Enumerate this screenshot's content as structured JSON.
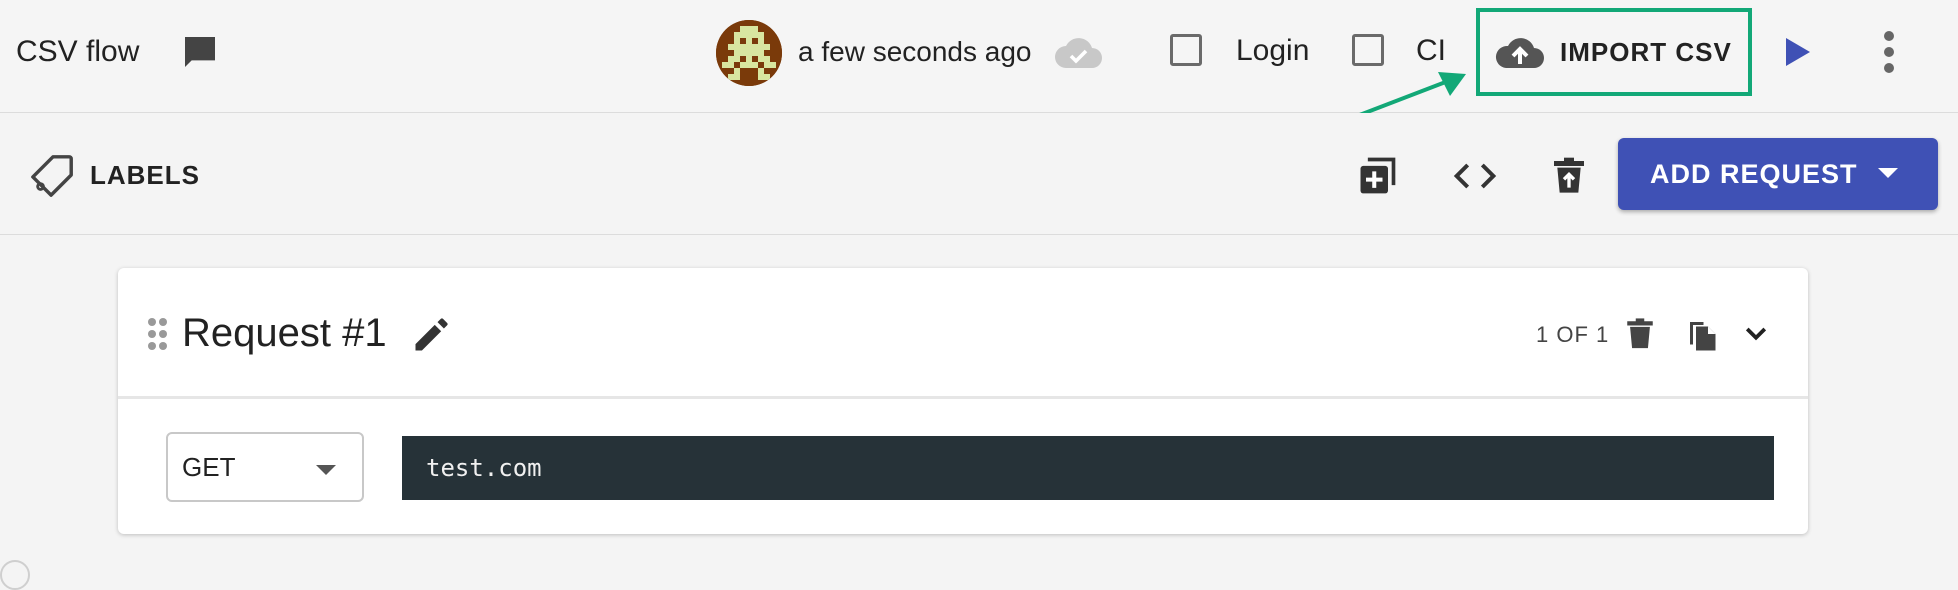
{
  "header": {
    "flow_title": "CSV flow",
    "icons": {
      "comment": "comment-icon",
      "cloud_status": "cloud-check-icon",
      "run": "play-icon",
      "more": "more-vert-icon"
    },
    "saved_status": "a few seconds ago",
    "checkboxes": [
      {
        "label": "Login",
        "checked": false
      },
      {
        "label": "CI",
        "checked": false
      }
    ],
    "import_csv_label": "IMPORT CSV",
    "highlight_color": "#12a877"
  },
  "toolbar": {
    "labels_label": "LABELS",
    "icons": [
      "add-box-icon",
      "code-icon",
      "delete-upload-icon"
    ],
    "add_request_label": "ADD REQUEST",
    "accent": "#3f51b5"
  },
  "request": {
    "title": "Request #1",
    "counter": "1 OF 1",
    "method": "GET",
    "url": "test.com",
    "url_bg": "#263238"
  }
}
